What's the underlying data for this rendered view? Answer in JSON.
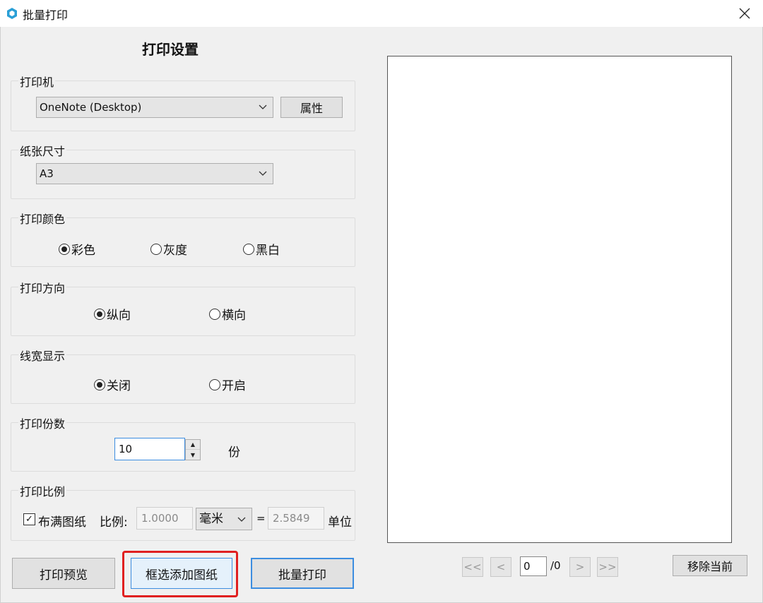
{
  "window": {
    "title": "批量打印"
  },
  "heading": "打印设置",
  "printer": {
    "group_label": "打印机",
    "selected": "OneNote (Desktop)",
    "properties_label": "属性"
  },
  "paper_size": {
    "group_label": "纸张尺寸",
    "selected": "A3"
  },
  "print_color": {
    "group_label": "打印颜色",
    "options": [
      {
        "label": "彩色",
        "selected": true
      },
      {
        "label": "灰度",
        "selected": false
      },
      {
        "label": "黑白",
        "selected": false
      }
    ]
  },
  "orientation": {
    "group_label": "打印方向",
    "options": [
      {
        "label": "纵向",
        "selected": true
      },
      {
        "label": "横向",
        "selected": false
      }
    ]
  },
  "line_width": {
    "group_label": "线宽显示",
    "options": [
      {
        "label": "关闭",
        "selected": true
      },
      {
        "label": "开启",
        "selected": false
      }
    ]
  },
  "copies": {
    "group_label": "打印份数",
    "value": "10",
    "unit": "份"
  },
  "scale": {
    "group_label": "打印比例",
    "fit_label": "布满图纸",
    "fit_checked": true,
    "ratio_label": "比例:",
    "ratio_value": "1.0000",
    "unit_selected": "毫米",
    "equals": "=",
    "units_value": "2.5849",
    "units_label": "单位"
  },
  "buttons": {
    "preview": "打印预览",
    "box_add": "框选添加图纸",
    "batch_print": "批量打印",
    "remove_current": "移除当前"
  },
  "pager": {
    "first": "<<",
    "prev": "<",
    "current": "0",
    "total": "/0",
    "next": ">",
    "last": ">>"
  },
  "colors": {
    "accent_blue": "#3c8de0",
    "highlight_red": "#e02020",
    "app_icon": "#2a9fd6"
  }
}
